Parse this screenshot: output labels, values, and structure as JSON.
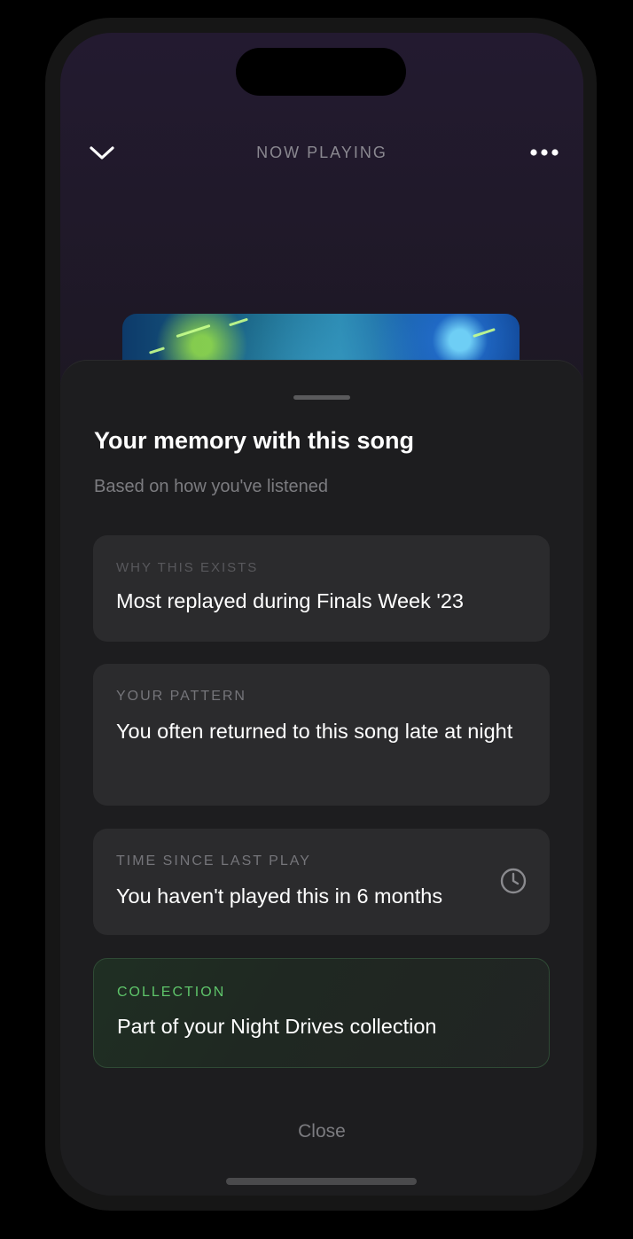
{
  "header": {
    "title": "NOW PLAYING",
    "collapse_icon": "chevron-down-icon",
    "more_icon": "more-horizontal-icon"
  },
  "sheet": {
    "title": "Your memory with this song",
    "subtitle": "Based on how you've listened",
    "cards": [
      {
        "label": "WHY THIS EXISTS",
        "value": "Most replayed during Finals Week '23"
      },
      {
        "label": "YOUR PATTERN",
        "value": "You often returned to this song late at night"
      },
      {
        "label": "TIME SINCE LAST PLAY",
        "value": "You haven't played this in 6 months",
        "icon": "clock-icon"
      },
      {
        "label": "COLLECTION",
        "value": "Part of your Night Drives collection"
      }
    ],
    "close_label": "Close"
  },
  "colors": {
    "accent_green": "#5ec46a",
    "sheet_background": "#1d1d1f",
    "card_background": "#2b2b2d"
  }
}
